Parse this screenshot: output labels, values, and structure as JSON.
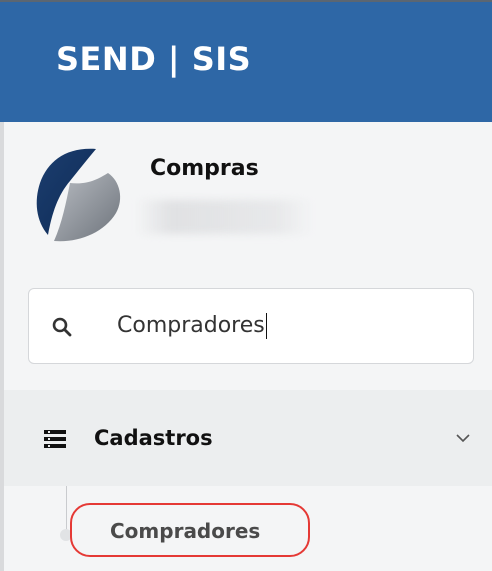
{
  "header": {
    "brand": "SEND | SIS"
  },
  "sidebar": {
    "module_name": "Compras",
    "search": {
      "value": "Compradores"
    },
    "menu": {
      "section_label": "Cadastros",
      "items": [
        {
          "label": "Compradores"
        }
      ]
    }
  },
  "colors": {
    "header_bg": "#2e67a6",
    "highlight": "#e53935"
  }
}
